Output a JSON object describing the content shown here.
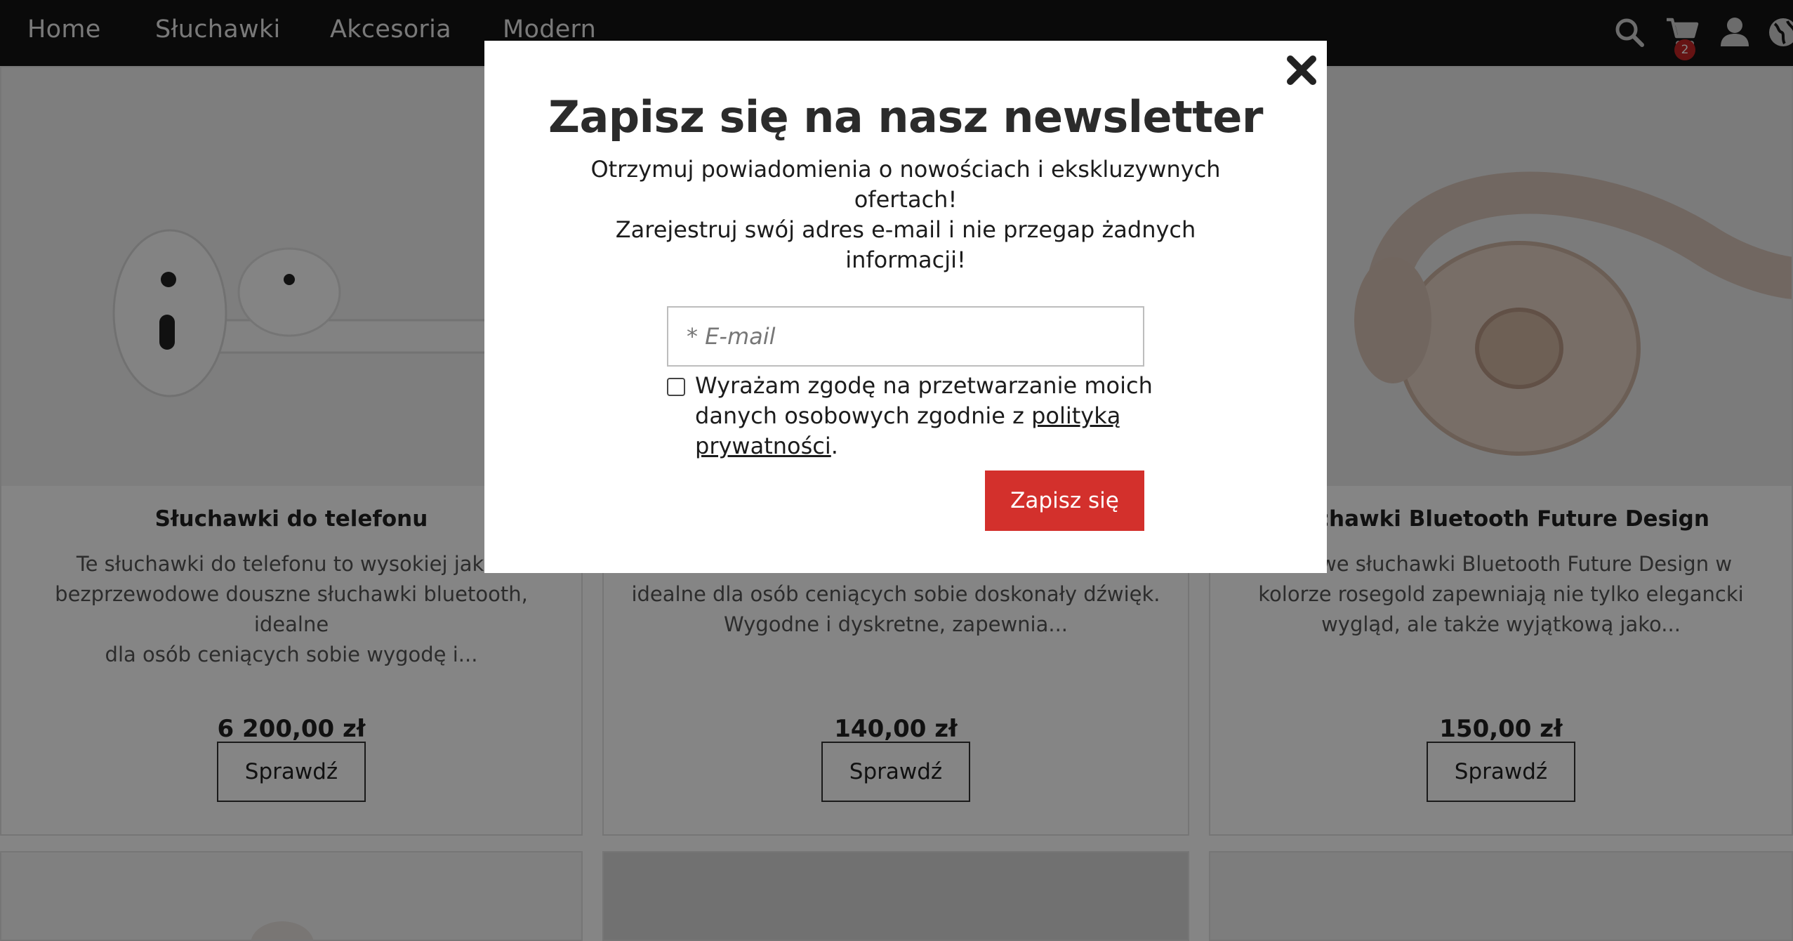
{
  "nav": {
    "links": [
      "Home",
      "Słuchawki",
      "Akcesoria",
      "Modern"
    ],
    "cart_count": "2"
  },
  "products": [
    {
      "title": "Słuchawki do telefonu",
      "description": "Te słuchawki do telefonu to wysokiej jakoś\nbezprzewodowe douszne słuchawki bluetooth, idealne\ndla osób ceniących sobie wygodę i...",
      "price": "6 200,00 zł",
      "button": "Sprawdź"
    },
    {
      "title": "",
      "description": "idealne dla osób ceniących sobie doskonały dźwięk.\nWygodne i dyskretne, zapewnia...",
      "price": "140,00 zł",
      "button": "Sprawdź"
    },
    {
      "title": "łuchawki Bluetooth Future Design",
      "description": "vodowe słuchawki Bluetooth Future Design w\nkolorze rosegold zapewniają nie tylko elegancki\nwygląd, ale także wyjątkową jako...",
      "price": "150,00 zł",
      "button": "Sprawdź"
    }
  ],
  "modal": {
    "title": "Zapisz się na nasz newsletter",
    "text_line1": "Otrzymuj powiadomienia o nowościach i ekskluzywnych ofertach!",
    "text_line2": "Zarejestruj swój adres e-mail i nie przegap żadnych informacji!",
    "email_placeholder": "* E-mail",
    "consent_text": "Wyrażam zgodę na przetwarzanie moich danych osobowych zgodnie z ",
    "consent_link": "polityką prywatności",
    "consent_end": ".",
    "submit_label": "Zapisz się"
  },
  "colors": {
    "nav_bg": "#141414",
    "accent": "#d3302c",
    "badge": "#c42626"
  }
}
